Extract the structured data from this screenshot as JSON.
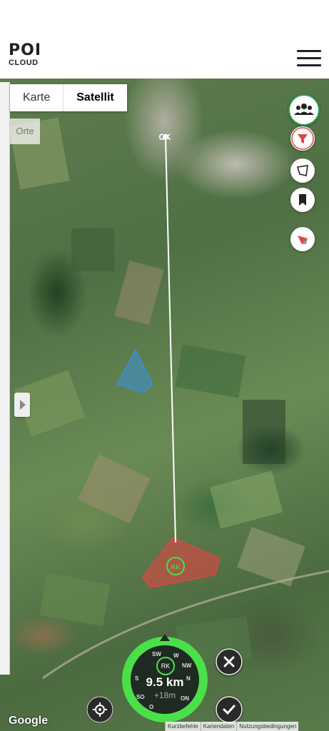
{
  "header": {
    "logo_poi": "POI",
    "logo_cloud": "CLOUD"
  },
  "map": {
    "map_type_options": [
      "Karte",
      "Satellit"
    ],
    "selected_map_type": "Satellit",
    "places_label": "Orte",
    "start_marker_label": "CK",
    "target_marker_label": "RK",
    "accent_green": "#4ae04a",
    "area_blue": "#3a8fd8",
    "area_red": "#e04545"
  },
  "right_toolbar": [
    "group-icon",
    "filter-icon",
    "polygon-icon",
    "bookmark-icon",
    "direction-icon"
  ],
  "compass": {
    "marker": "RK",
    "distance": "9.5 km",
    "altitude": "+18m",
    "directions": [
      "SW",
      "W",
      "NW",
      "N",
      "ON",
      "O",
      "SO",
      "S"
    ]
  },
  "attribution": {
    "brand": "Google",
    "links": [
      "Kurzbefehle",
      "Kartendaten",
      "Nutzungsbedingungen"
    ]
  }
}
